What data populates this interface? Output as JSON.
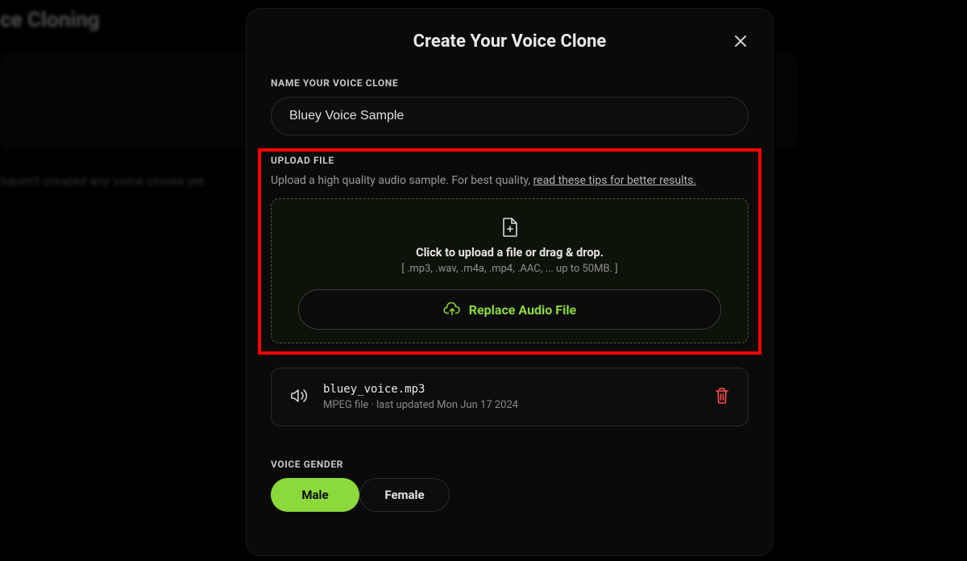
{
  "background": {
    "page_title": "ce Cloning",
    "empty_text": "haven't created any voice clones yet"
  },
  "modal": {
    "title": "Create Your Voice Clone",
    "name_section": {
      "label": "NAME YOUR VOICE CLONE",
      "value": "Bluey Voice Sample"
    },
    "upload_section": {
      "label": "UPLOAD FILE",
      "desc_prefix": "Upload a high quality audio sample. For best quality, ",
      "desc_link": "read these tips for better results.",
      "dropzone_line1": "Click to upload a file or drag & drop.",
      "dropzone_line2": "[ .mp3, .wav, .m4a, .mp4, .AAC, ... up to 50MB. ]",
      "replace_label": "Replace Audio File"
    },
    "uploaded_file": {
      "name": "bluey_voice.mp3",
      "subtitle": "MPEG file · last updated Mon Jun 17 2024"
    },
    "gender": {
      "label": "VOICE GENDER",
      "options": [
        "Male",
        "Female"
      ],
      "selected": "Male"
    }
  },
  "colors": {
    "accent_green": "#8bd93a",
    "danger_red": "#ff4d4d",
    "highlight_red": "#ff0000"
  }
}
